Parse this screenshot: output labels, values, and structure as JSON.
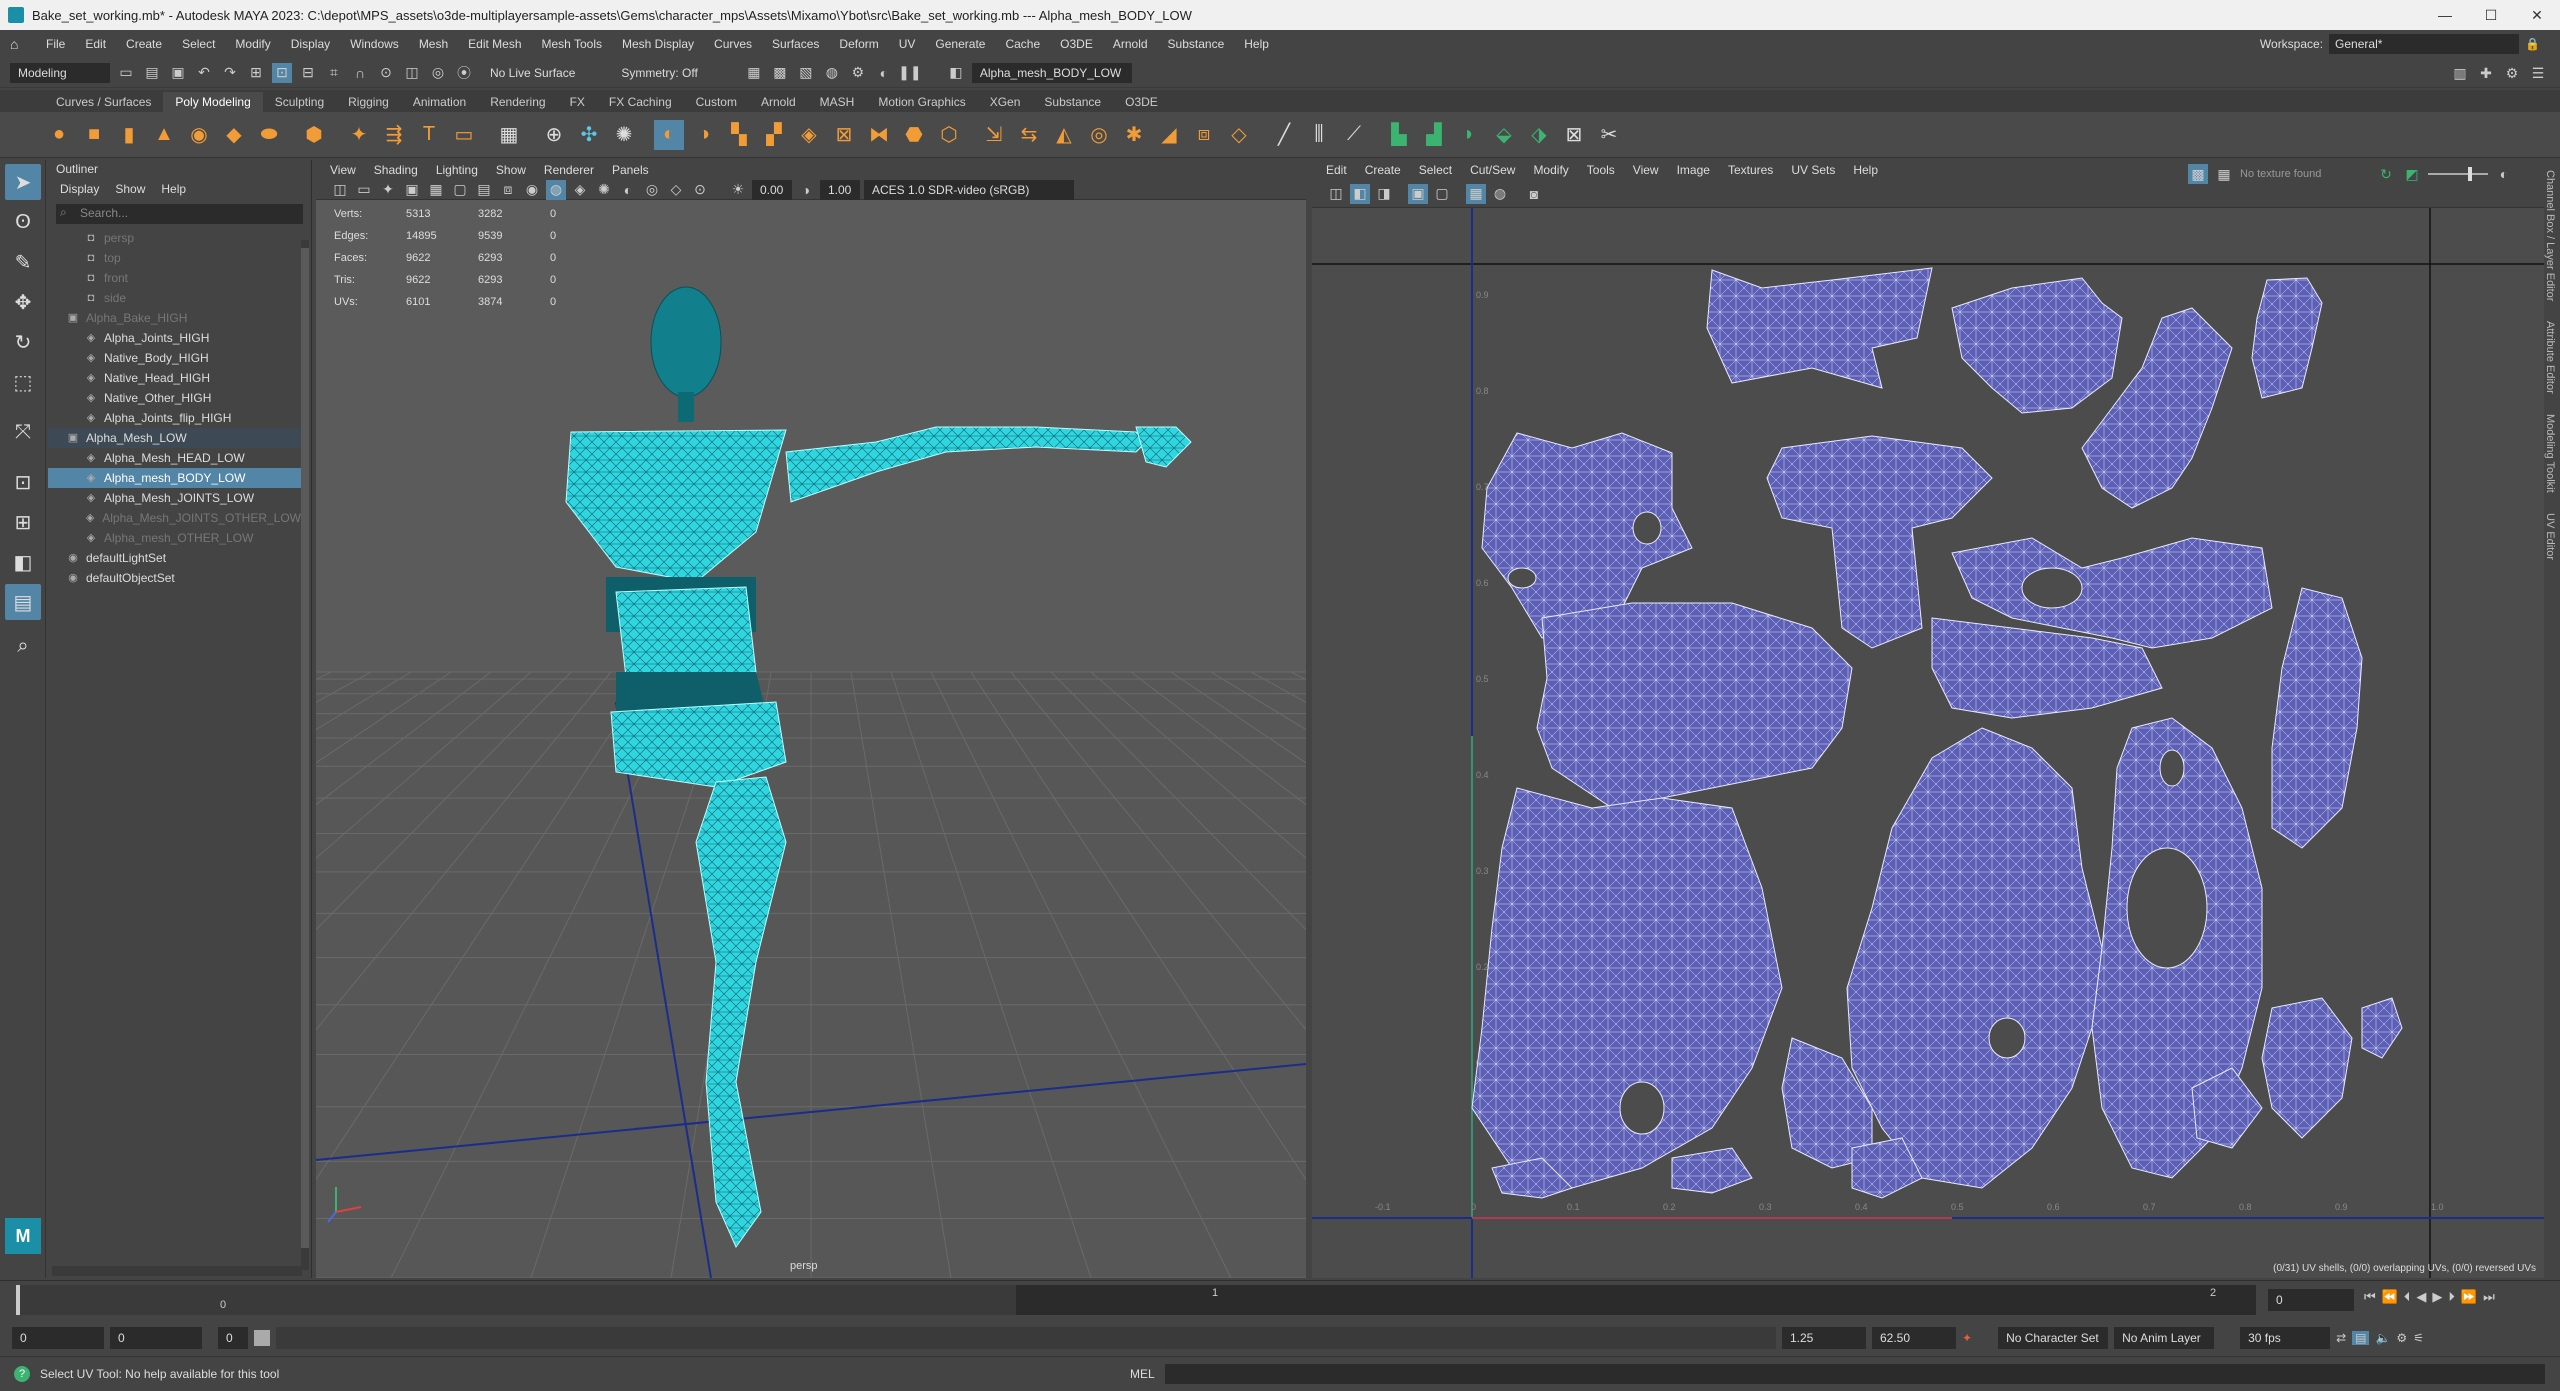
{
  "window": {
    "title": "Bake_set_working.mb* - Autodesk MAYA 2023: C:\\depot\\MPS_assets\\o3de-multiplayersample-assets\\Gems\\character_mps\\Assets\\Mixamo\\Ybot\\src\\Bake_set_working.mb  ---  Alpha_mesh_BODY_LOW",
    "buttons": [
      "—",
      "☐",
      "✕"
    ]
  },
  "menubar": [
    "File",
    "Edit",
    "Create",
    "Select",
    "Modify",
    "Display",
    "Windows",
    "Mesh",
    "Edit Mesh",
    "Mesh Tools",
    "Mesh Display",
    "Curves",
    "Surfaces",
    "Deform",
    "UV",
    "Generate",
    "Cache",
    "O3DE",
    "Arnold",
    "Substance",
    "Help"
  ],
  "workspace": {
    "label": "Workspace:",
    "value": "General*"
  },
  "statusline": {
    "mode": "Modeling",
    "live_surface": "No Live Surface",
    "symmetry": "Symmetry: Off",
    "object_name": "Alpha_mesh_BODY_LOW"
  },
  "shelf_tabs": [
    "Curves / Surfaces",
    "Poly Modeling",
    "Sculpting",
    "Rigging",
    "Animation",
    "Rendering",
    "FX",
    "FX Caching",
    "Custom",
    "Arnold",
    "MASH",
    "Motion Graphics",
    "XGen",
    "Substance",
    "O3DE"
  ],
  "shelf_active": "Poly Modeling",
  "outliner": {
    "title": "Outliner",
    "menu": [
      "Display",
      "Show",
      "Help"
    ],
    "search_placeholder": "Search...",
    "items": [
      {
        "label": "persp",
        "dim": true,
        "indent": 1,
        "icon": "camera-icon"
      },
      {
        "label": "top",
        "dim": true,
        "indent": 1,
        "icon": "camera-icon"
      },
      {
        "label": "front",
        "dim": true,
        "indent": 1,
        "icon": "camera-icon"
      },
      {
        "label": "side",
        "dim": true,
        "indent": 1,
        "icon": "camera-icon"
      },
      {
        "label": "Alpha_Bake_HIGH",
        "dim": true,
        "indent": 0,
        "icon": "group-icon"
      },
      {
        "label": "Alpha_Joints_HIGH",
        "indent": 1,
        "icon": "mesh-icon"
      },
      {
        "label": "Native_Body_HIGH",
        "indent": 1,
        "icon": "mesh-icon"
      },
      {
        "label": "Native_Head_HIGH",
        "indent": 1,
        "icon": "mesh-icon"
      },
      {
        "label": "Native_Other_HIGH",
        "indent": 1,
        "icon": "mesh-icon"
      },
      {
        "label": "Alpha_Joints_flip_HIGH",
        "indent": 1,
        "icon": "mesh-icon"
      },
      {
        "label": "Alpha_Mesh_LOW",
        "indent": 0,
        "icon": "group-icon",
        "sub": true
      },
      {
        "label": "Alpha_Mesh_HEAD_LOW",
        "indent": 1,
        "icon": "mesh-icon"
      },
      {
        "label": "Alpha_mesh_BODY_LOW",
        "indent": 1,
        "icon": "mesh-icon",
        "sel": true
      },
      {
        "label": "Alpha_Mesh_JOINTS_LOW",
        "indent": 1,
        "icon": "mesh-icon"
      },
      {
        "label": "Alpha_Mesh_JOINTS_OTHER_LOW",
        "dim": true,
        "indent": 1,
        "icon": "mesh-icon"
      },
      {
        "label": "Alpha_mesh_OTHER_LOW",
        "dim": true,
        "indent": 1,
        "icon": "mesh-icon"
      },
      {
        "label": "defaultLightSet",
        "indent": 0,
        "icon": "set-icon"
      },
      {
        "label": "defaultObjectSet",
        "indent": 0,
        "icon": "set-icon"
      }
    ]
  },
  "viewport": {
    "menu": [
      "View",
      "Shading",
      "Lighting",
      "Show",
      "Renderer",
      "Panels"
    ],
    "exposure": "0.00",
    "gamma": "1.00",
    "colorspace": "ACES 1.0 SDR-video (sRGB)",
    "camera": "persp",
    "hud": [
      {
        "label": "Verts:",
        "a": "5313",
        "b": "3282",
        "c": "0"
      },
      {
        "label": "Edges:",
        "a": "14895",
        "b": "9539",
        "c": "0"
      },
      {
        "label": "Faces:",
        "a": "9622",
        "b": "6293",
        "c": "0"
      },
      {
        "label": "Tris:",
        "a": "9622",
        "b": "6293",
        "c": "0"
      },
      {
        "label": "UVs:",
        "a": "6101",
        "b": "3874",
        "c": "0"
      }
    ]
  },
  "uv_editor": {
    "menu": [
      "Edit",
      "Create",
      "Select",
      "Cut/Sew",
      "Modify",
      "Tools",
      "View",
      "Image",
      "Textures",
      "UV Sets",
      "Help"
    ],
    "texture_status": "No texture found",
    "footer": "(0/31) UV shells, (0/0) overlapping UVs, (0/0) reversed UVs",
    "u_ticks": [
      "-0.1",
      "0",
      "0.1",
      "0.2",
      "0.3",
      "0.4",
      "0.5",
      "0.6",
      "0.7",
      "0.8",
      "0.9",
      "1.0"
    ],
    "v_ticks": [
      "0.9",
      "0.8",
      "0.7",
      "0.6",
      "0.5",
      "0.4",
      "0.3",
      "0.2",
      "0.1"
    ],
    "shell_fill": "#5d5fb5",
    "wire_color": "#d8dcff"
  },
  "right_tabs": [
    "Channel Box / Layer Editor",
    "Attribute Editor",
    "Modeling Toolkit",
    "UV Editor"
  ],
  "timeline": {
    "ticks": [
      "1",
      "0",
      "1",
      "2"
    ],
    "current_frame": "0"
  },
  "range": {
    "start": "0",
    "start2": "0",
    "layer": "0",
    "anim_start": "1.25",
    "anim_end": "62.50",
    "character_set": "No Character Set",
    "anim_layer": "No Anim Layer",
    "fps": "30 fps"
  },
  "helpline": {
    "text": "Select UV Tool: No help available for this tool",
    "lang": "MEL"
  },
  "colors": {
    "accent": "#5285a6",
    "mesh_cyan": "#2fd6e0",
    "mesh_dark": "#0f5f6a"
  }
}
